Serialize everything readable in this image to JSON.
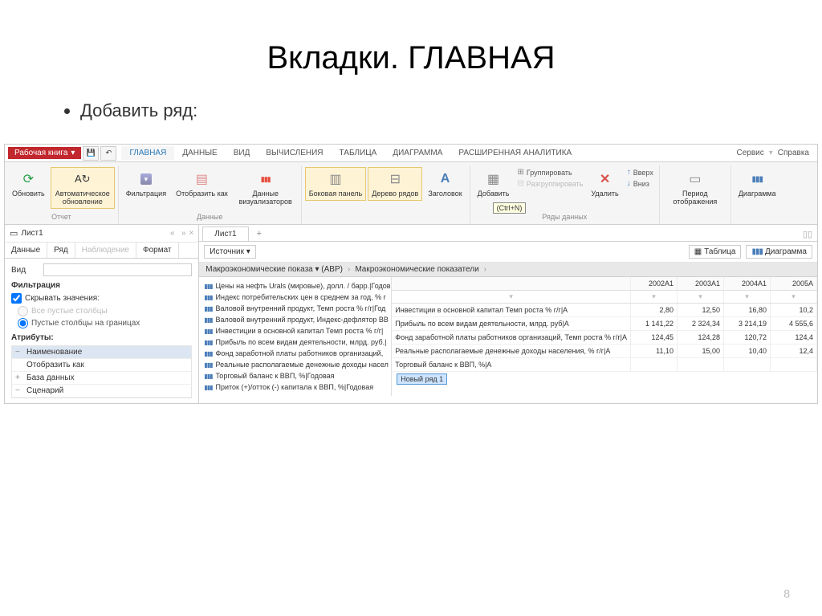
{
  "slide": {
    "title": "Вкладки. ГЛАВНАЯ",
    "bullet": "Добавить ряд:",
    "page_number": "8"
  },
  "menubar": {
    "workbook": "Рабочая книга",
    "tabs": [
      "ГЛАВНАЯ",
      "ДАННЫЕ",
      "ВИД",
      "ВЫЧИСЛЕНИЯ",
      "ТАБЛИЦА",
      "ДИАГРАММА",
      "РАСШИРЕННАЯ АНАЛИТИКА"
    ],
    "active_tab": "ГЛАВНАЯ",
    "right": {
      "service": "Сервис",
      "help": "Справка"
    }
  },
  "ribbon": {
    "group_report": {
      "caption": "Отчет",
      "refresh": "Обновить",
      "auto_update": "Автоматическое обновление"
    },
    "group_data": {
      "caption": "Данные",
      "filter": "Фильтрация",
      "display_as": "Отобразить как",
      "viz_data": "Данные визуализаторов"
    },
    "group_panels": {
      "side_panel": "Боковая панель",
      "row_tree": "Дерево рядов",
      "header": "Заголовок"
    },
    "group_rows": {
      "caption": "Ряды данных",
      "add": "Добавить",
      "add_hotkey": "(Ctrl+N)",
      "group": "Группировать",
      "ungroup": "Разгруппировать",
      "delete": "Удалить",
      "up": "Вверх",
      "down": "Вниз"
    },
    "group_period": {
      "period": "Период отображения"
    },
    "group_chart": {
      "chart": "Диаграмма"
    }
  },
  "sheets": {
    "sheet1": "Лист1"
  },
  "left_panel": {
    "tabs": {
      "data": "Данные",
      "row": "Ряд",
      "observation": "Наблюдение",
      "format": "Формат"
    },
    "view_label": "Вид",
    "filter_title": "Фильтрация",
    "hide_values": "Скрывать значения:",
    "radio_all_empty": "Все пустые столбцы",
    "radio_empty_edges": "Пустые столбцы на границах",
    "attrs_title": "Атрибуты:",
    "attrs": [
      "Наименование",
      "Отобразить как",
      "База данных",
      "Сценарий"
    ]
  },
  "toolbar2": {
    "source": "Источник",
    "table": "Таблица",
    "diagram": "Диаграмма"
  },
  "breadcrumb": {
    "c1": "Макроэкономические показа ▾ (АВР)",
    "c2": "Макроэкономические показатели"
  },
  "series": [
    "Цены на нефть Urals (мировые), долл. / барр.|Годов",
    "Индекс потребительских цен в среднем за год, % г",
    "Валовой внутренний продукт, Темп роста % г/г|Год",
    "Валовой внутренний продукт, Индекс-дефлятор ВВ",
    "Инвестиции в основной капитал Темп роста % г/г|",
    "Прибыль по всем видам деятельности, млрд. руб.|",
    "Фонд заработной платы работников организаций,",
    "Реальные располагаемые денежные доходы насел",
    "Торговый баланс к ВВП, %|Годовая",
    "Приток (+)/отток (-) капитала к ВВП, %|Годовая"
  ],
  "table": {
    "years": [
      "2002A1",
      "2003A1",
      "2004A1",
      "2005A"
    ],
    "rows": [
      {
        "name": "Инвестиции в основной капитал Темп роста % г/г|A",
        "vals": [
          "2,80",
          "12,50",
          "16,80",
          "10,2"
        ]
      },
      {
        "name": "Прибыль по всем видам деятельности, млрд. руб|A",
        "vals": [
          "1 141,22",
          "2 324,34",
          "3 214,19",
          "4 555,6"
        ]
      },
      {
        "name": "Фонд заработной платы работников организаций, Темп роста % г/г|A",
        "vals": [
          "124,45",
          "124,28",
          "120,72",
          "124,4"
        ]
      },
      {
        "name": "Реальные располагаемые денежные доходы населения, % г/г|A",
        "vals": [
          "11,10",
          "15,00",
          "10,40",
          "12,4"
        ]
      },
      {
        "name": "Торговый баланс к ВВП, %|A",
        "vals": [
          "",
          "",
          "",
          ""
        ]
      }
    ],
    "new_row": "Новый ряд 1"
  }
}
